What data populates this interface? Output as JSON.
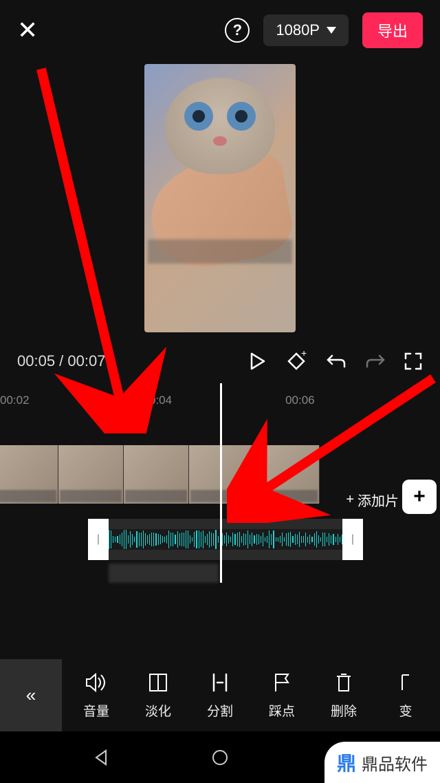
{
  "header": {
    "resolution": "1080P",
    "export": "导出"
  },
  "time": {
    "current": "00:05",
    "total": "00:07",
    "marks": [
      "00:02",
      "00:04",
      "00:06"
    ]
  },
  "add_clip": "添加片",
  "tools": {
    "back": "«",
    "items": [
      {
        "label": "音量",
        "icon": "volume"
      },
      {
        "label": "淡化",
        "icon": "fade"
      },
      {
        "label": "分割",
        "icon": "split"
      },
      {
        "label": "踩点",
        "icon": "beat"
      },
      {
        "label": "删除",
        "icon": "delete"
      },
      {
        "label": "变",
        "icon": "more"
      }
    ]
  },
  "watermark": "鼎品软件"
}
